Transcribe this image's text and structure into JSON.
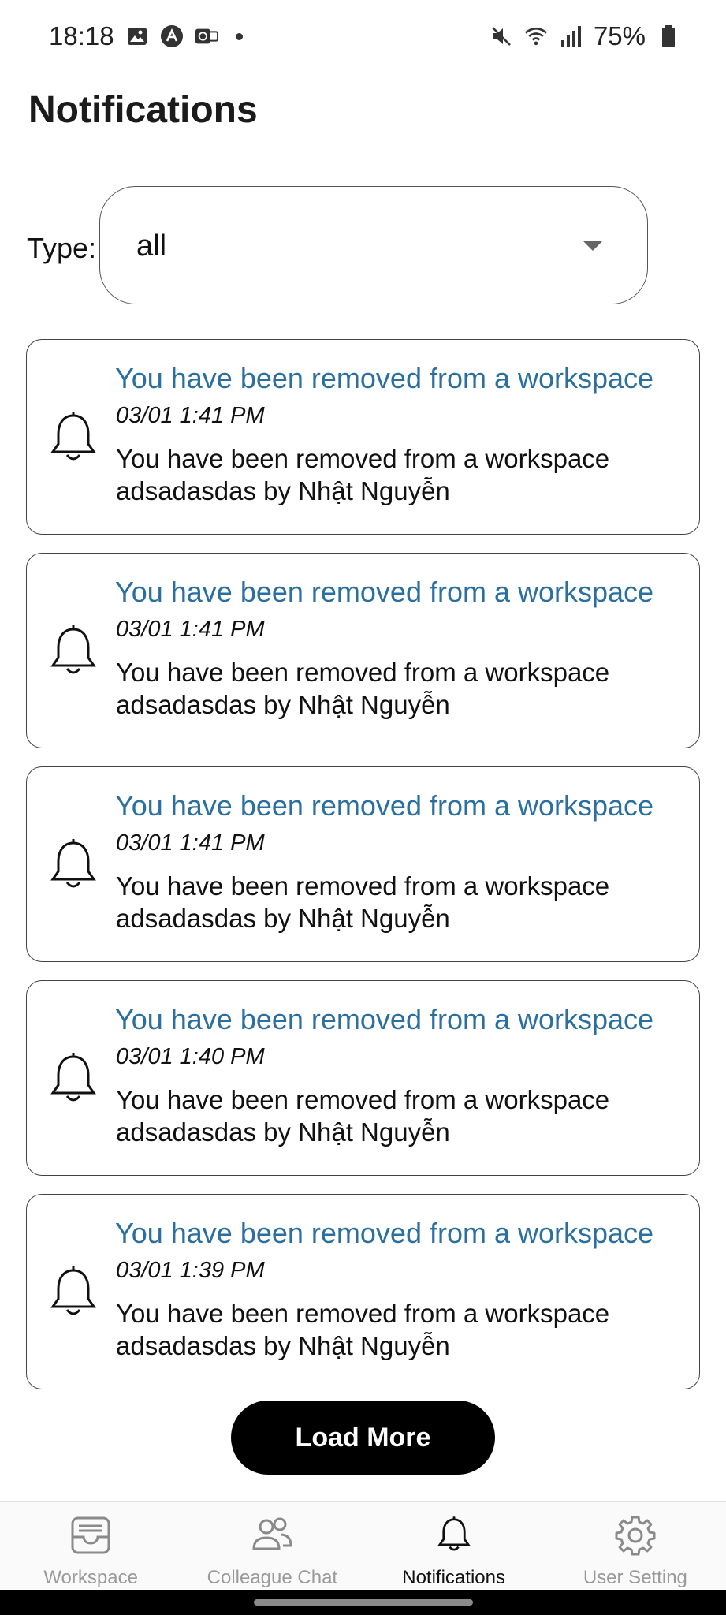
{
  "status_bar": {
    "time": "18:18",
    "left_icons": [
      "gallery-icon",
      "app-icon",
      "vpn-icon"
    ],
    "right_icons": [
      "mute-icon",
      "wifi-icon",
      "signal-icon"
    ],
    "battery": "75%"
  },
  "header": {
    "title": "Notifications"
  },
  "filter": {
    "label": "Type:",
    "selected": "all"
  },
  "notifications": [
    {
      "title": "You have been removed from a workspace",
      "time": "03/01 1:41 PM",
      "body": "You have been removed from a workspace adsadasdas by Nhật Nguyễn"
    },
    {
      "title": "You have been removed from a workspace",
      "time": "03/01 1:41 PM",
      "body": "You have been removed from a workspace adsadasdas by Nhật Nguyễn"
    },
    {
      "title": "You have been removed from a workspace",
      "time": "03/01 1:41 PM",
      "body": "You have been removed from a workspace adsadasdas by Nhật Nguyễn"
    },
    {
      "title": "You have been removed from a workspace",
      "time": "03/01 1:40 PM",
      "body": "You have been removed from a workspace adsadasdas by Nhật Nguyễn"
    },
    {
      "title": "You have been removed from a workspace",
      "time": "03/01 1:39 PM",
      "body": "You have been removed from a workspace adsadasdas by Nhật Nguyễn"
    }
  ],
  "actions": {
    "load_more": "Load More"
  },
  "bottom_nav": {
    "items": [
      {
        "label": "Workspace",
        "icon": "inbox-icon",
        "active": false
      },
      {
        "label": "Colleague Chat",
        "icon": "people-icon",
        "active": false
      },
      {
        "label": "Notifications",
        "icon": "bell-icon",
        "active": true
      },
      {
        "label": "User Setting",
        "icon": "gear-icon",
        "active": false
      }
    ]
  },
  "colors": {
    "title_blue": "#2a6fa0",
    "button_black": "#000000",
    "nav_inactive": "#9a9a9a"
  }
}
